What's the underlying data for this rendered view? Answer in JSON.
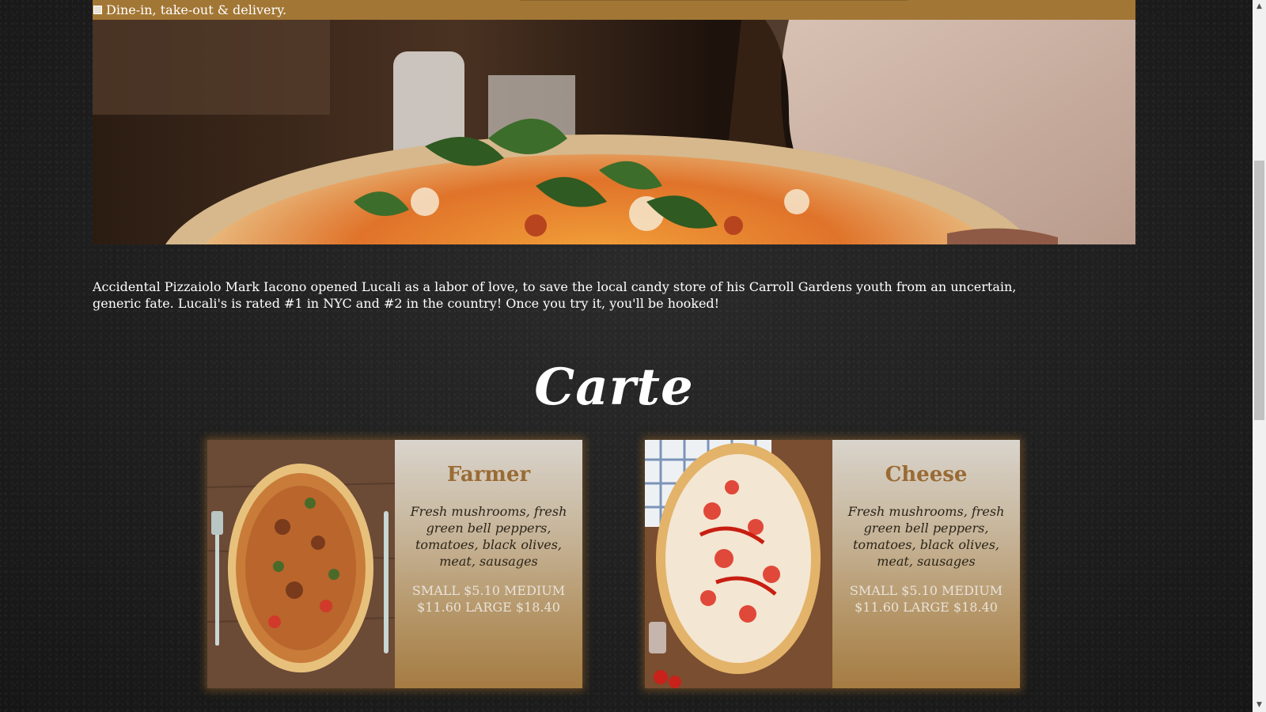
{
  "banner": {
    "text": "Dine-in, take-out & delivery."
  },
  "intro": {
    "text": "Accidental Pizzaiolo Mark Iacono opened Lucali as a labor of love, to save the local candy store of his Carroll Gardens youth from an uncertain, generic fate. Lucali's is rated #1 in NYC and #2 in the country! Once you try it, you'll be hooked!"
  },
  "menu": {
    "title": "Carte",
    "items": [
      {
        "name": "Farmer",
        "description": "Fresh mushrooms, fresh green bell peppers, tomatoes, black olives, meat, sausages",
        "price": "SMALL $5.10 MEDIUM $11.60 LARGE $18.40"
      },
      {
        "name": "Cheese",
        "description": "Fresh mushrooms, fresh green bell peppers, tomatoes, black olives, meat, sausages",
        "price": "SMALL $5.10 MEDIUM $11.60 LARGE $18.40"
      }
    ]
  },
  "colors": {
    "accent": "#a27634",
    "page_background": "#1f1f1f",
    "item_name": "#9a6b35"
  },
  "icons": {
    "scroll_up": "▲",
    "scroll_down": "▼"
  }
}
